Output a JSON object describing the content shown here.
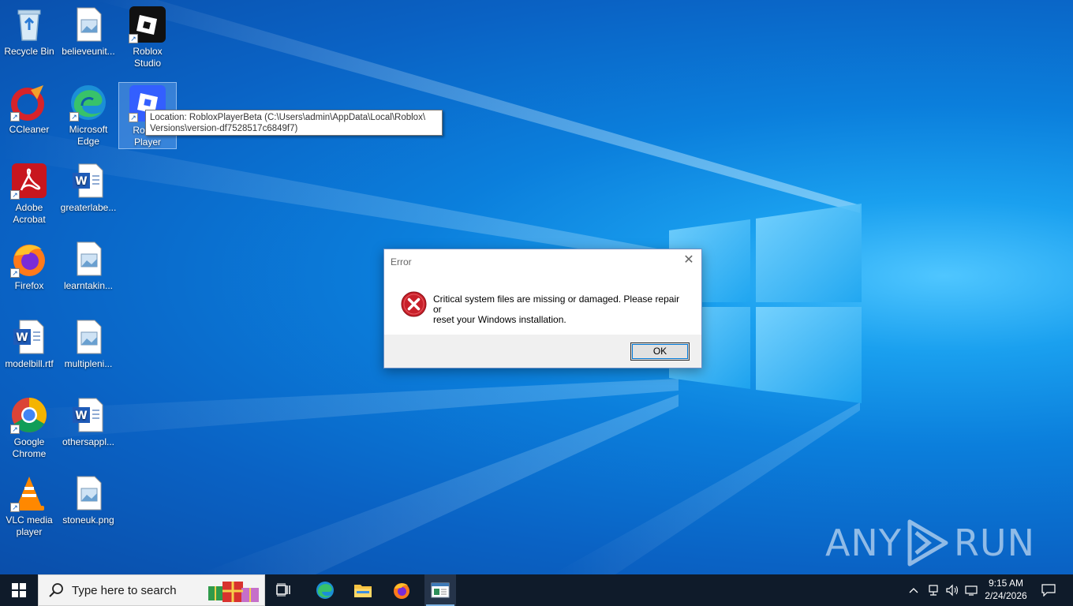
{
  "desktop_icons": [
    {
      "name": "Recycle Bin",
      "icon": "recycle-bin-icon"
    },
    {
      "name": "believeunit...",
      "icon": "image-file-icon"
    },
    {
      "name": "Roblox Studio",
      "icon": "roblox-studio-icon"
    },
    {
      "name": "CCleaner",
      "icon": "ccleaner-icon"
    },
    {
      "name": "Microsoft Edge",
      "icon": "edge-icon"
    },
    {
      "name": "Roblox Player",
      "icon": "roblox-player-icon"
    },
    {
      "name": "Adobe Acrobat",
      "icon": "acrobat-icon"
    },
    {
      "name": "greaterlabe...",
      "icon": "word-doc-icon"
    },
    {
      "name": "Firefox",
      "icon": "firefox-icon"
    },
    {
      "name": "learntakin...",
      "icon": "image-file-icon"
    },
    {
      "name": "modelbill.rtf",
      "icon": "word-doc-icon"
    },
    {
      "name": "multipleni...",
      "icon": "image-file-icon"
    },
    {
      "name": "Google Chrome",
      "icon": "chrome-icon"
    },
    {
      "name": "othersappl...",
      "icon": "word-doc-icon"
    },
    {
      "name": "VLC media player",
      "icon": "vlc-icon"
    },
    {
      "name": "stoneuk.png",
      "icon": "image-file-icon"
    }
  ],
  "tooltip": {
    "line1": "Location: RobloxPlayerBeta (C:\\Users\\admin\\AppData\\Local\\Roblox\\",
    "line2": "Versions\\version-df7528517c6849f7)"
  },
  "dialog": {
    "title": "Error",
    "message_line1": "Critical system files are missing or damaged. Please repair or",
    "message_line2": "reset your Windows installation.",
    "ok_label": "OK"
  },
  "watermark": {
    "left": "ANY",
    "right": "RUN"
  },
  "taskbar": {
    "search_placeholder": "Type here to search",
    "time": "9:15 AM",
    "date": "2/24/2026"
  },
  "colors": {
    "taskbar": "#0f1b2a",
    "desktop_accent": "#0b7fdc",
    "error_red": "#c8202a"
  }
}
